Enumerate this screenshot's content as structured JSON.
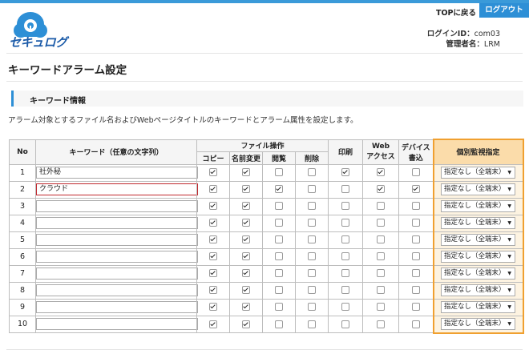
{
  "header": {
    "logo_text": "セキュログ",
    "top_link": "TOPに戻る",
    "logout_label": "ログアウト",
    "login_id_label": "ログインID：",
    "login_id_value": "com03",
    "admin_label": "管理者名：",
    "admin_value": "LRM"
  },
  "page_title": "キーワードアラーム設定",
  "section": {
    "title": "キーワード情報",
    "description": "アラーム対象とするファイル名およびWebページタイトルのキーワードとアラーム属性を設定します。"
  },
  "table": {
    "headers": {
      "no": "No",
      "keyword": "キーワード（任意の文字列）",
      "file_ops": "ファイル操作",
      "copy": "コピー",
      "rename": "名前変更",
      "view": "閲覧",
      "delete": "削除",
      "print": "印刷",
      "web_access_1": "Web",
      "web_access_2": "アクセス",
      "device_write_1": "デバイス",
      "device_write_2": "書込",
      "individual": "個別監視指定"
    },
    "rows": [
      {
        "no": "1",
        "keyword": "社外秘",
        "copy": true,
        "rename": true,
        "view": false,
        "delete": false,
        "print": true,
        "web": true,
        "device": false,
        "monitor": "指定なし（全端末）"
      },
      {
        "no": "2",
        "keyword": "クラウド",
        "copy": true,
        "rename": true,
        "view": true,
        "delete": false,
        "print": false,
        "web": true,
        "device": true,
        "monitor": "指定なし（全端末）"
      },
      {
        "no": "3",
        "keyword": "",
        "copy": true,
        "rename": true,
        "view": false,
        "delete": false,
        "print": false,
        "web": false,
        "device": false,
        "monitor": "指定なし（全端末）"
      },
      {
        "no": "4",
        "keyword": "",
        "copy": true,
        "rename": true,
        "view": false,
        "delete": false,
        "print": false,
        "web": false,
        "device": false,
        "monitor": "指定なし（全端末）"
      },
      {
        "no": "5",
        "keyword": "",
        "copy": true,
        "rename": true,
        "view": false,
        "delete": false,
        "print": false,
        "web": false,
        "device": false,
        "monitor": "指定なし（全端末）"
      },
      {
        "no": "6",
        "keyword": "",
        "copy": true,
        "rename": true,
        "view": false,
        "delete": false,
        "print": false,
        "web": false,
        "device": false,
        "monitor": "指定なし（全端末）"
      },
      {
        "no": "7",
        "keyword": "",
        "copy": true,
        "rename": true,
        "view": false,
        "delete": false,
        "print": false,
        "web": false,
        "device": false,
        "monitor": "指定なし（全端末）"
      },
      {
        "no": "8",
        "keyword": "",
        "copy": true,
        "rename": true,
        "view": false,
        "delete": false,
        "print": false,
        "web": false,
        "device": false,
        "monitor": "指定なし（全端末）"
      },
      {
        "no": "9",
        "keyword": "",
        "copy": true,
        "rename": true,
        "view": false,
        "delete": false,
        "print": false,
        "web": false,
        "device": false,
        "monitor": "指定なし（全端末）"
      },
      {
        "no": "10",
        "keyword": "",
        "copy": true,
        "rename": true,
        "view": false,
        "delete": false,
        "print": false,
        "web": false,
        "device": false,
        "monitor": "指定なし（全端末）"
      }
    ]
  },
  "colors": {
    "accent": "#2d8fd6",
    "highlight_border": "#f0a030",
    "error_border": "#c0282e"
  }
}
